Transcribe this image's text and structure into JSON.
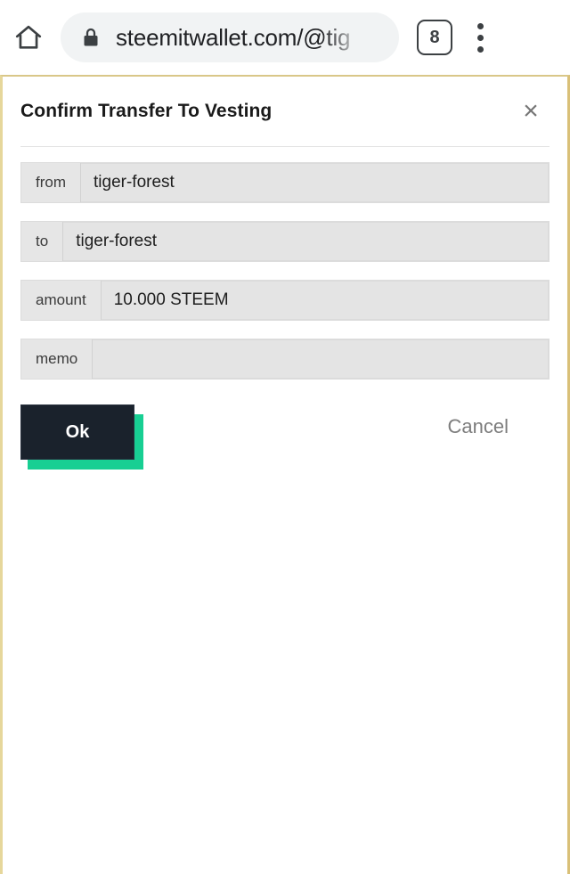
{
  "browser": {
    "home_icon": "home-icon",
    "lock_icon": "lock-icon",
    "url": "steemitwallet.com/@tig",
    "tab_count": "8",
    "menu_icon": "overflow-menu-icon"
  },
  "dialog": {
    "title": "Confirm Transfer To Vesting",
    "close_label": "×",
    "fields": [
      {
        "label": "from",
        "value": "tiger-forest"
      },
      {
        "label": "to",
        "value": "tiger-forest"
      },
      {
        "label": "amount",
        "value": "10.000 STEEM"
      },
      {
        "label": "memo",
        "value": ""
      }
    ],
    "ok_label": "Ok",
    "cancel_label": "Cancel"
  },
  "colors": {
    "accent_green": "#19cf94",
    "button_dark": "#1a222c",
    "page_border": "#d9c788",
    "field_bg": "#e6e6e6"
  }
}
